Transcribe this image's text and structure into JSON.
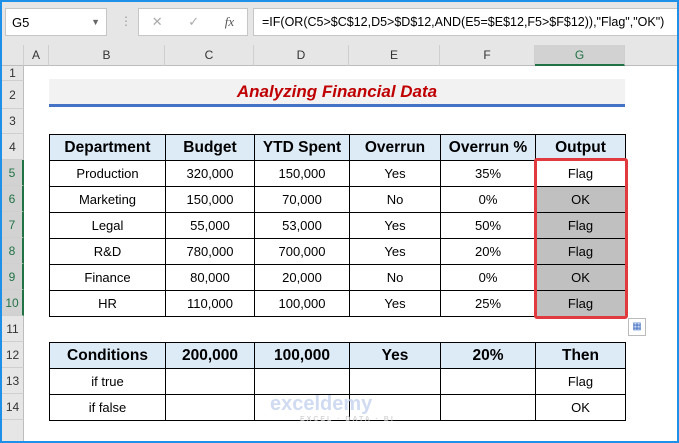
{
  "formula_bar": {
    "name_box": "G5",
    "cancel_icon": "✕",
    "enter_icon": "✓",
    "fx_label": "fx",
    "formula": "=IF(OR(C5>$C$12,D5>$D$12,AND(E5=$E$12,F5>$F$12)),\"Flag\",\"OK\")"
  },
  "columns": [
    "A",
    "B",
    "C",
    "D",
    "E",
    "F",
    "G"
  ],
  "rows": [
    "1",
    "2",
    "3",
    "4",
    "5",
    "6",
    "7",
    "8",
    "9",
    "10",
    "11",
    "12",
    "13",
    "14"
  ],
  "title": "Analyzing Financial Data",
  "table": {
    "headers": [
      "Department",
      "Budget",
      "YTD Spent",
      "Overrun",
      "Overrun %",
      "Output"
    ],
    "rows": [
      [
        "Production",
        "320,000",
        "150,000",
        "Yes",
        "35%",
        "Flag"
      ],
      [
        "Marketing",
        "150,000",
        "70,000",
        "No",
        "0%",
        "OK"
      ],
      [
        "Legal",
        "55,000",
        "53,000",
        "Yes",
        "50%",
        "Flag"
      ],
      [
        "R&D",
        "780,000",
        "700,000",
        "Yes",
        "20%",
        "Flag"
      ],
      [
        "Finance",
        "80,000",
        "20,000",
        "No",
        "0%",
        "OK"
      ],
      [
        "HR",
        "110,000",
        "100,000",
        "Yes",
        "25%",
        "Flag"
      ]
    ]
  },
  "conditions": {
    "headers": [
      "Conditions",
      "200,000",
      "100,000",
      "Yes",
      "20%",
      "Then"
    ],
    "rows": [
      [
        "if true",
        "",
        "",
        "",
        "",
        "Flag"
      ],
      [
        "if false",
        "",
        "",
        "",
        "",
        "OK"
      ]
    ]
  },
  "watermark": {
    "name": "exceldemy",
    "tagline": "EXCEL · DATA · BI"
  }
}
